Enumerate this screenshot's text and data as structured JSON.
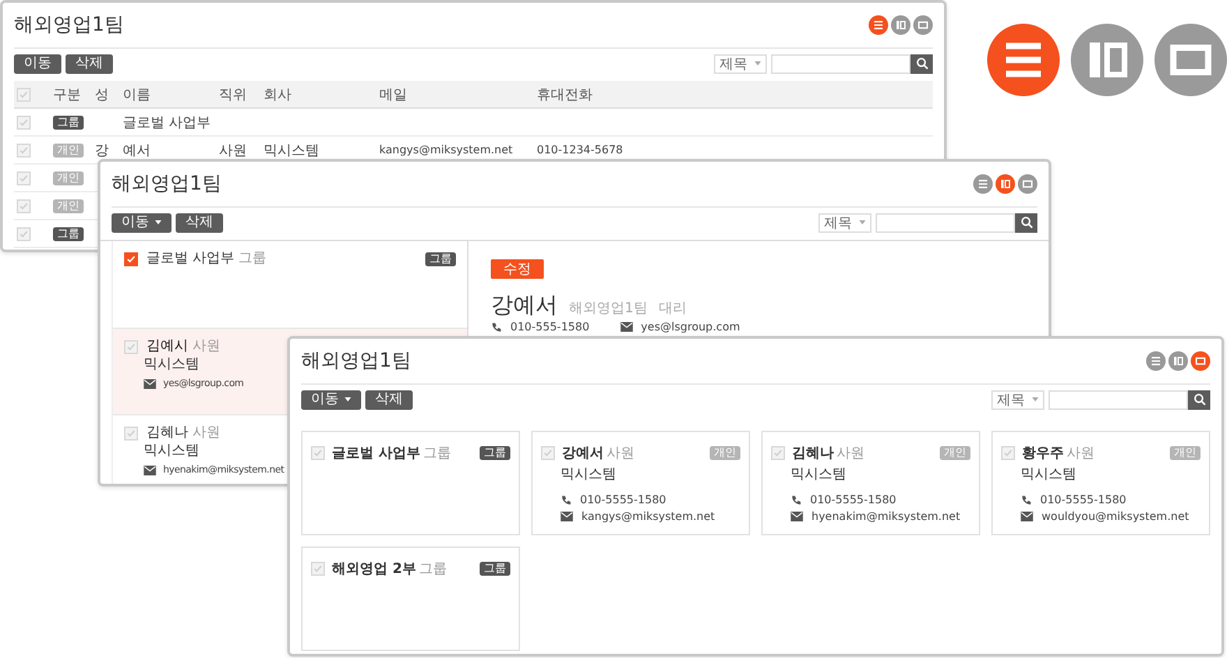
{
  "view_switcher": [
    {
      "kind": "list",
      "selected": true
    },
    {
      "kind": "split",
      "selected": false
    },
    {
      "kind": "card",
      "selected": false
    }
  ],
  "windows": [
    {
      "kind": "list",
      "title": "해외영업1팀",
      "views": [
        {
          "kind": "list",
          "selected": true
        },
        {
          "kind": "split",
          "selected": false
        },
        {
          "kind": "card",
          "selected": false
        }
      ],
      "toolbar": {
        "move": {
          "label": "이동",
          "dropdown": false
        },
        "delete": "삭제",
        "search_select": "제목"
      },
      "table": {
        "header_checked": false,
        "columns": [
          "구분",
          "성",
          "이름",
          "직위",
          "회사",
          "메일",
          "휴대전화"
        ],
        "rows": [
          {
            "kind": "group",
            "checked": false,
            "badge": "그룹",
            "name": "글로벌 사업부"
          },
          {
            "kind": "person",
            "checked": false,
            "badge": "개인",
            "surname": "강",
            "name": "예서",
            "position": "사원",
            "company": "믹시스템",
            "email": "kangys@miksystem.net",
            "phone": "010-1234-5678"
          },
          {
            "kind": "person",
            "checked": false,
            "badge": "개인"
          },
          {
            "kind": "person",
            "checked": false,
            "badge": "개인"
          },
          {
            "kind": "group",
            "checked": false,
            "badge": "그룹"
          }
        ]
      }
    },
    {
      "kind": "split",
      "title": "해외영업1팀",
      "views": [
        {
          "kind": "list",
          "selected": false
        },
        {
          "kind": "split",
          "selected": true
        },
        {
          "kind": "card",
          "selected": false
        }
      ],
      "toolbar": {
        "move": {
          "label": "이동",
          "dropdown": true
        },
        "delete": "삭제",
        "search_select": "제목"
      },
      "items": [
        {
          "kind": "group",
          "checked": true,
          "selected": false,
          "name": "글로벌 사업부",
          "role": "그룹",
          "badge": "그룹"
        },
        {
          "kind": "person",
          "checked": false,
          "selected": true,
          "name": "김예시",
          "role": "사원",
          "company": "믹시스템",
          "email": "yes@lsgroup.com"
        },
        {
          "kind": "person",
          "checked": false,
          "selected": false,
          "name": "김혜나",
          "role": "사원",
          "company": "믹시스템",
          "email": "hyenakim@miksystem.net"
        }
      ],
      "detail": {
        "edit": "수정",
        "name": "강예서",
        "department": "해외영업1팀",
        "position": "대리",
        "phone": "010-555-1580",
        "email": "yes@lsgroup.com"
      }
    },
    {
      "kind": "card",
      "title": "해외영업1팀",
      "views": [
        {
          "kind": "list",
          "selected": false
        },
        {
          "kind": "split",
          "selected": false
        },
        {
          "kind": "card",
          "selected": true
        }
      ],
      "toolbar": {
        "move": {
          "label": "이동",
          "dropdown": true
        },
        "delete": "삭제",
        "search_select": "제목"
      },
      "cards": [
        {
          "kind": "group",
          "checked": false,
          "name": "글로벌 사업부",
          "role": "그룹",
          "badge": "그룹"
        },
        {
          "kind": "person",
          "checked": false,
          "name": "강예서",
          "role": "사원",
          "badge": "개인",
          "company": "믹시스템",
          "phone": "010-5555-1580",
          "email": "kangys@miksystem.net"
        },
        {
          "kind": "person",
          "checked": false,
          "name": "김혜나",
          "role": "사원",
          "badge": "개인",
          "company": "믹시스템",
          "phone": "010-5555-1580",
          "email": "hyenakim@miksystem.net"
        },
        {
          "kind": "person",
          "checked": false,
          "name": "황우주",
          "role": "사원",
          "badge": "개인",
          "company": "믹시스템",
          "phone": "010-5555-1580",
          "email": "wouldyou@miksystem.net"
        },
        {
          "kind": "group",
          "checked": false,
          "name": "해외영업 2부",
          "role": "그룹",
          "badge": "그룹"
        }
      ]
    }
  ]
}
